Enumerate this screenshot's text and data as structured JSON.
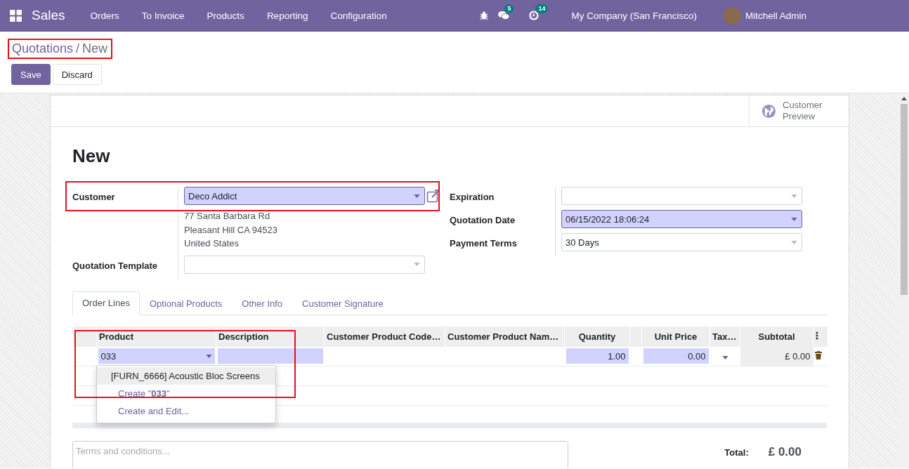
{
  "navbar": {
    "app_name": "Sales",
    "menu": [
      "Orders",
      "To Invoice",
      "Products",
      "Reporting",
      "Configuration"
    ],
    "messages_count": "5",
    "activities_count": "14",
    "company": "My Company (San Francisco)",
    "user": "Mitchell Admin"
  },
  "control_panel": {
    "breadcrumb": [
      {
        "label": "Quotations",
        "kind": "link"
      },
      {
        "label": "New",
        "kind": "current"
      }
    ],
    "separator": "/",
    "highlighted": true,
    "buttons": [
      {
        "label": "Save",
        "kind": "primary"
      },
      {
        "label": "Discard",
        "kind": "secondary"
      }
    ]
  },
  "sheet": {
    "button_box": [
      {
        "label": "Customer Preview"
      }
    ],
    "title": "New",
    "left_fields": [
      {
        "label": "Customer",
        "value": "Deco Addict",
        "required": true,
        "highlighted": true,
        "external_link": true,
        "address": [
          "77 Santa Barbara Rd",
          "Pleasant Hill CA 94523",
          "United States"
        ]
      },
      {
        "label": "Quotation Template",
        "required": false,
        "highlighted": false,
        "external_link": false
      }
    ],
    "right_fields": [
      {
        "label": "Expiration",
        "required": false
      },
      {
        "label": "Quotation Date",
        "value": "06/15/2022 18:06:24",
        "required": true
      },
      {
        "label": "Payment Terms",
        "value": "30 Days",
        "required": false
      }
    ],
    "tabs": [
      {
        "label": "Order Lines",
        "selected": true
      },
      {
        "label": "Optional Products",
        "selected": false
      },
      {
        "label": "Other Info",
        "selected": false
      },
      {
        "label": "Customer Signature",
        "selected": false
      }
    ],
    "table": {
      "highlighted": true,
      "columns": [
        {
          "label": "Product"
        },
        {
          "label": "Description"
        },
        {
          "label": "Customer Product Code…"
        },
        {
          "label": "Customer Product Nam…"
        },
        {
          "label": "Quantity"
        },
        {},
        {
          "label": "Unit Price"
        },
        {
          "label": "Tax…"
        },
        {
          "label": "Subtotal"
        }
      ],
      "rows": [
        {
          "cells": [
            {
              "kind": "dropdown",
              "value": "033",
              "required": true
            },
            {
              "kind": "input",
              "required": true
            },
            {
              "kind": "text"
            },
            {
              "kind": "text"
            },
            {
              "kind": "input",
              "value": "1.00",
              "required": true
            },
            {
              "kind": "text"
            },
            {
              "kind": "input",
              "value": "0.00",
              "required": true
            },
            {
              "kind": "caret"
            },
            {
              "kind": "readonly",
              "value": "£ 0.00"
            }
          ]
        }
      ],
      "autocomplete": [
        {
          "label": "[FURN_6666] Acoustic Bloc Screens",
          "kind": "option",
          "selected": true
        },
        {
          "label": "Create \"**033**\"",
          "kind": "action",
          "selected": false
        },
        {
          "label": "Create and Edit...",
          "kind": "action",
          "selected": false
        }
      ]
    },
    "terms_placeholder": "Terms and conditions...",
    "total_label": "Total:",
    "total_value": "£ 0.00"
  }
}
